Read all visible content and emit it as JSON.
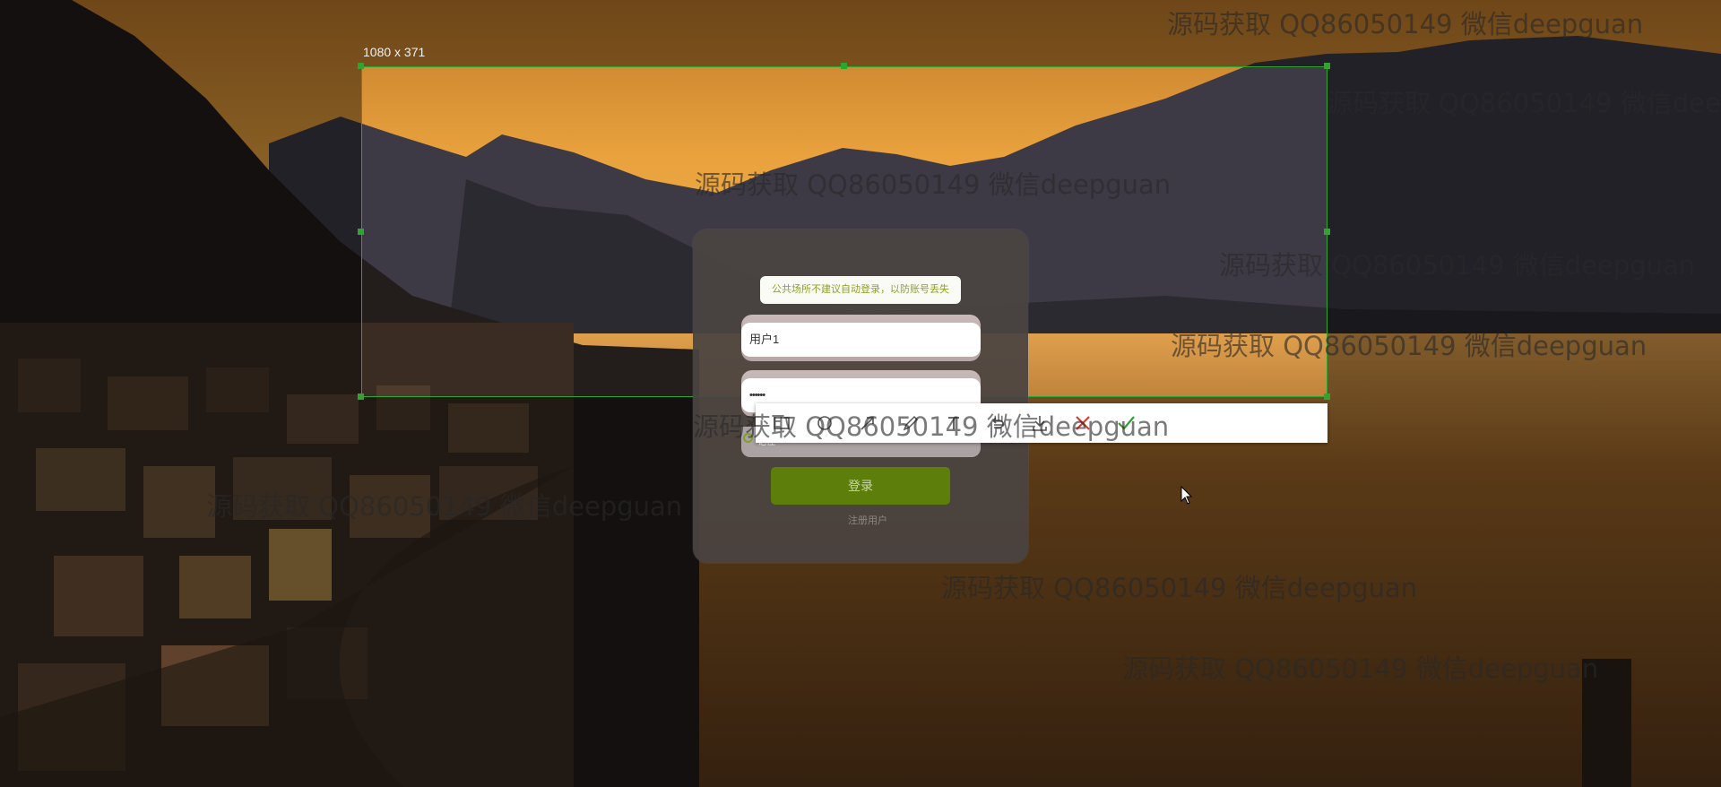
{
  "selection": {
    "size_label": "1080 x 371"
  },
  "login": {
    "notice": "公共场所不建议自动登录，以防账号丢失",
    "username_value": "用户1",
    "password_mask": "••••••",
    "remember_label": "记住",
    "login_button": "登录",
    "register_link": "注册用户"
  },
  "toolbar": {
    "tools": [
      {
        "icon": "rectangle-icon"
      },
      {
        "icon": "ellipse-icon"
      },
      {
        "icon": "arrow-icon"
      },
      {
        "icon": "pen-icon"
      },
      {
        "icon": "text-icon"
      },
      {
        "icon": "undo-icon"
      },
      {
        "icon": "download-icon"
      },
      {
        "icon": "close-icon"
      },
      {
        "icon": "check-icon"
      }
    ]
  },
  "watermarks": [
    "源码获取 QQ86050149 微信deepguan",
    "源码获取 QQ86050149 微信deepguan",
    "源码获取 QQ86050149 微信deepguan",
    "源码获取 QQ86050149 微信deepguan",
    "源码获取 QQ86050149 微信deepguan",
    "源码获取 QQ86050149 微信deepguan",
    "源码获取 QQ86050149 微信deepguan",
    "源码获取 QQ86050149 微信deepguan",
    "源码获取 QQ86050149 微信deepguan"
  ],
  "colors": {
    "selection_border": "#2ea52e",
    "login_button": "#5d7e0b",
    "notice_text": "#8ba22a",
    "close_red": "#e0322b",
    "check_green": "#2fa12f"
  }
}
